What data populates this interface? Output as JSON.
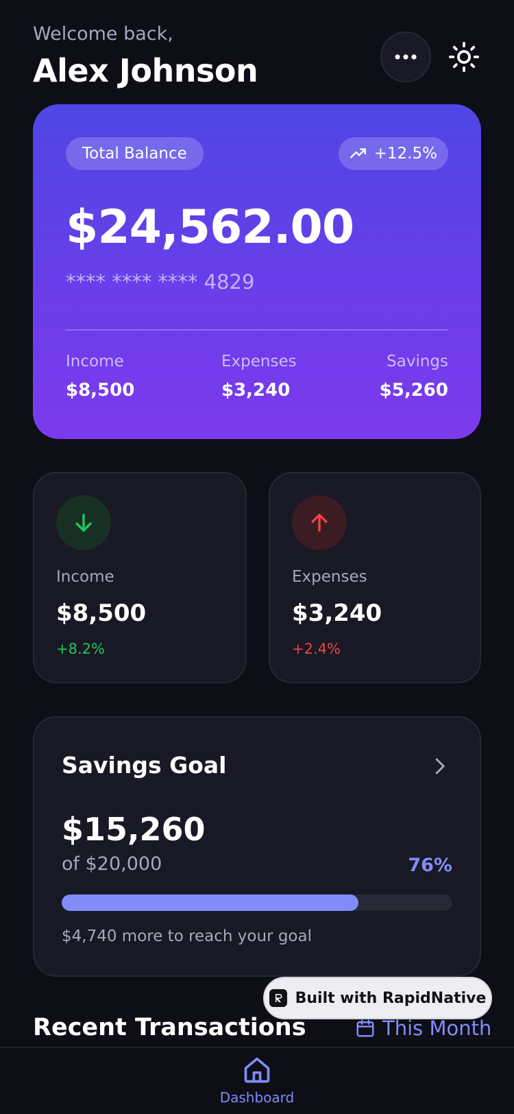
{
  "header": {
    "welcome": "Welcome back,",
    "name": "Alex Johnson"
  },
  "balance_card": {
    "label": "Total Balance",
    "change": "+12.5%",
    "amount": "$24,562.00",
    "card_number": "**** **** **** 4829",
    "stats": [
      {
        "label": "Income",
        "value": "$8,500"
      },
      {
        "label": "Expenses",
        "value": "$3,240"
      },
      {
        "label": "Savings",
        "value": "$5,260"
      }
    ]
  },
  "mini_cards": {
    "income": {
      "label": "Income",
      "value": "$8,500",
      "change": "+8.2%"
    },
    "expenses": {
      "label": "Expenses",
      "value": "$3,240",
      "change": "+2.4%"
    }
  },
  "savings_goal": {
    "title": "Savings Goal",
    "amount": "$15,260",
    "target": "of $20,000",
    "percent_label": "76%",
    "progress": 0.76,
    "remaining": "$4,740 more to reach your goal"
  },
  "badge": {
    "text": "Built with RapidNative"
  },
  "transactions": {
    "title": "Recent Transactions",
    "filter": "This Month"
  },
  "nav": {
    "items": [
      {
        "label": "Dashboard",
        "icon": "home-icon",
        "active": true
      }
    ]
  },
  "colors": {
    "background": "#0d0e16",
    "card": "#181925",
    "accent": "#818cf8",
    "positive": "#22c55e",
    "negative": "#ef4444",
    "gradient_start": "#4f46e5",
    "gradient_end": "#7c3aed"
  }
}
